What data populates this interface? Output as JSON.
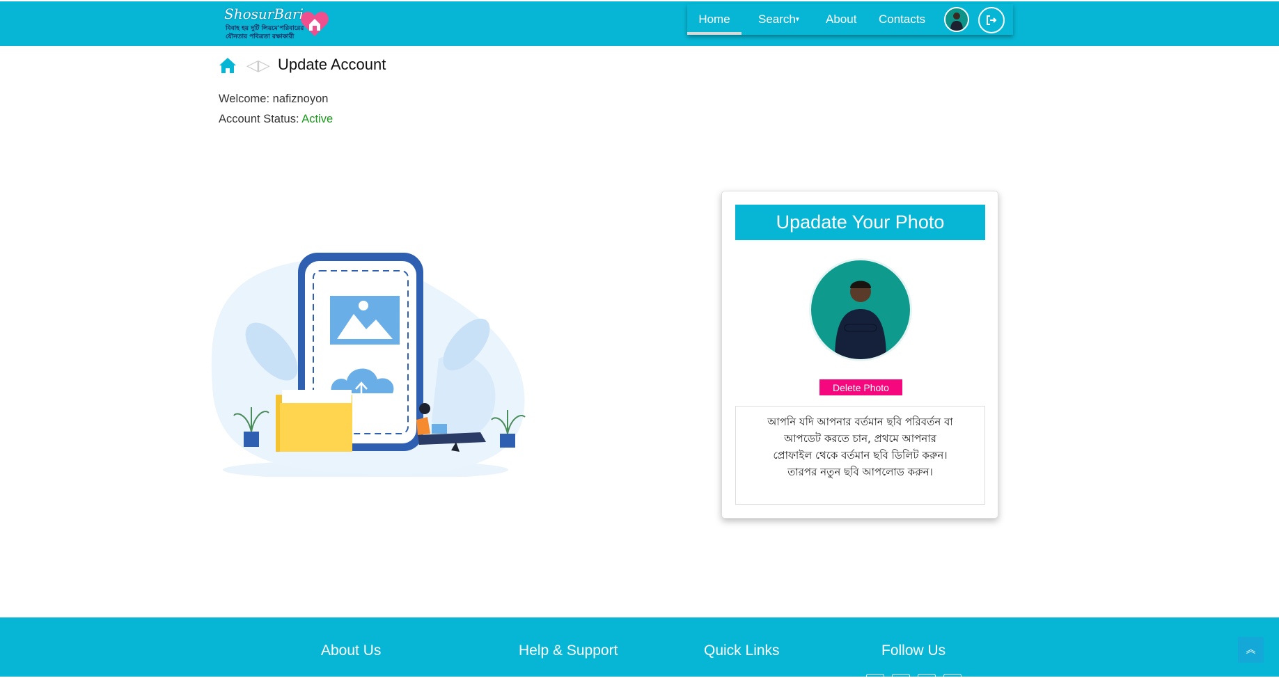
{
  "colors": {
    "brand": "#07b6d5",
    "active_status": "#1a9a1a",
    "delete_button": "#f5087e"
  },
  "logo": {
    "title": "ShosurBari",
    "line1": "বিবাহ হয় দুটি লিয়মে'পরিবারের",
    "line2": "যৌনতার পবিত্রতা রক্ষাকারী",
    "icon": "heart-house-icon"
  },
  "nav": {
    "home": "Home",
    "search": "Search",
    "about": "About",
    "contacts": "Contacts",
    "avatar_icon": "user-avatar",
    "logout_icon": "sign-out-icon"
  },
  "breadcrumb": {
    "home_icon": "home-icon",
    "separator": "◁▷",
    "title": "Update Account"
  },
  "account": {
    "welcome_label": "Welcome:",
    "username": "nafiznoyon",
    "status_label": "Account Status:",
    "status_value": "Active"
  },
  "photo_card": {
    "header": "Upadate Your Photo",
    "delete_label": "Delete Photo",
    "info_text": "আপনি যদি আপনার বর্তমান ছবি পরিবর্তন বা আপডেট করতে চান, প্রথমে আপনার প্রোফাইল থেকে বর্তমান ছবি ডিলিট করুন। তারপর নতুন ছবি আপলোড করুন।"
  },
  "footer": {
    "about": "About Us",
    "help": "Help & Support",
    "quick": "Quick Links",
    "follow": "Follow Us",
    "scroll_top_icon": "double-chevron-up-icon",
    "scroll_top_glyph": "︽"
  }
}
